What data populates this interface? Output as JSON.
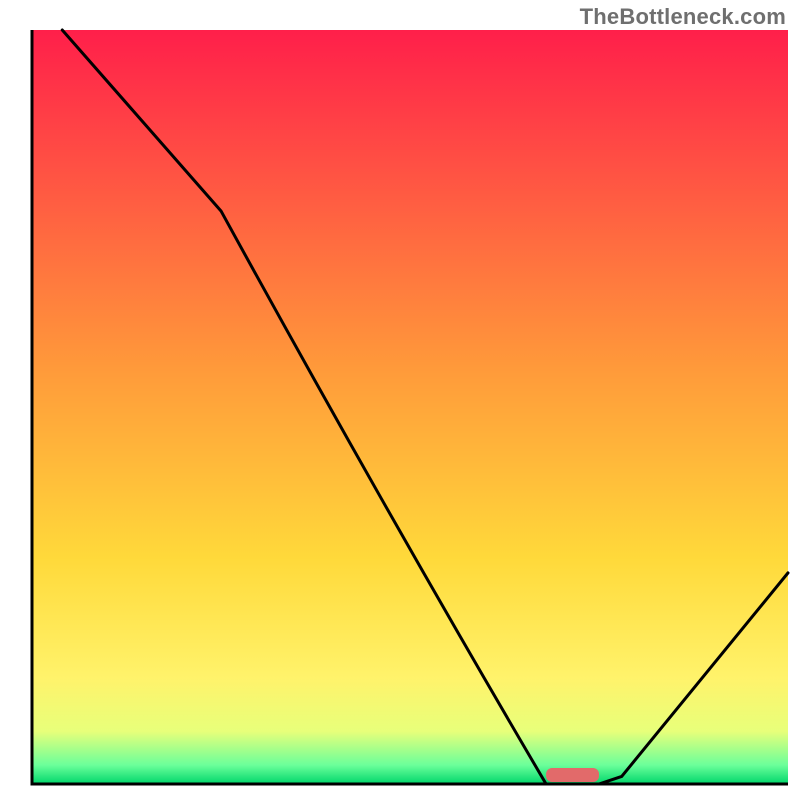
{
  "watermark": "TheBottleneck.com",
  "chart_data": {
    "type": "line",
    "title": "",
    "xlabel": "",
    "ylabel": "",
    "xlim": [
      0,
      100
    ],
    "ylim": [
      0,
      100
    ],
    "x": [
      4,
      25,
      68,
      75,
      78,
      100
    ],
    "values": [
      100,
      76,
      0,
      0,
      1,
      28
    ],
    "marker": {
      "x_start": 68,
      "x_end": 75,
      "color": "#e26a6a"
    },
    "background_gradient_stops": [
      {
        "offset": 0.0,
        "color": "#ff1f4a"
      },
      {
        "offset": 0.45,
        "color": "#ff9a3a"
      },
      {
        "offset": 0.7,
        "color": "#ffd93a"
      },
      {
        "offset": 0.86,
        "color": "#fff36b"
      },
      {
        "offset": 0.93,
        "color": "#e8ff7a"
      },
      {
        "offset": 0.975,
        "color": "#6bff9a"
      },
      {
        "offset": 1.0,
        "color": "#00d66b"
      }
    ]
  }
}
